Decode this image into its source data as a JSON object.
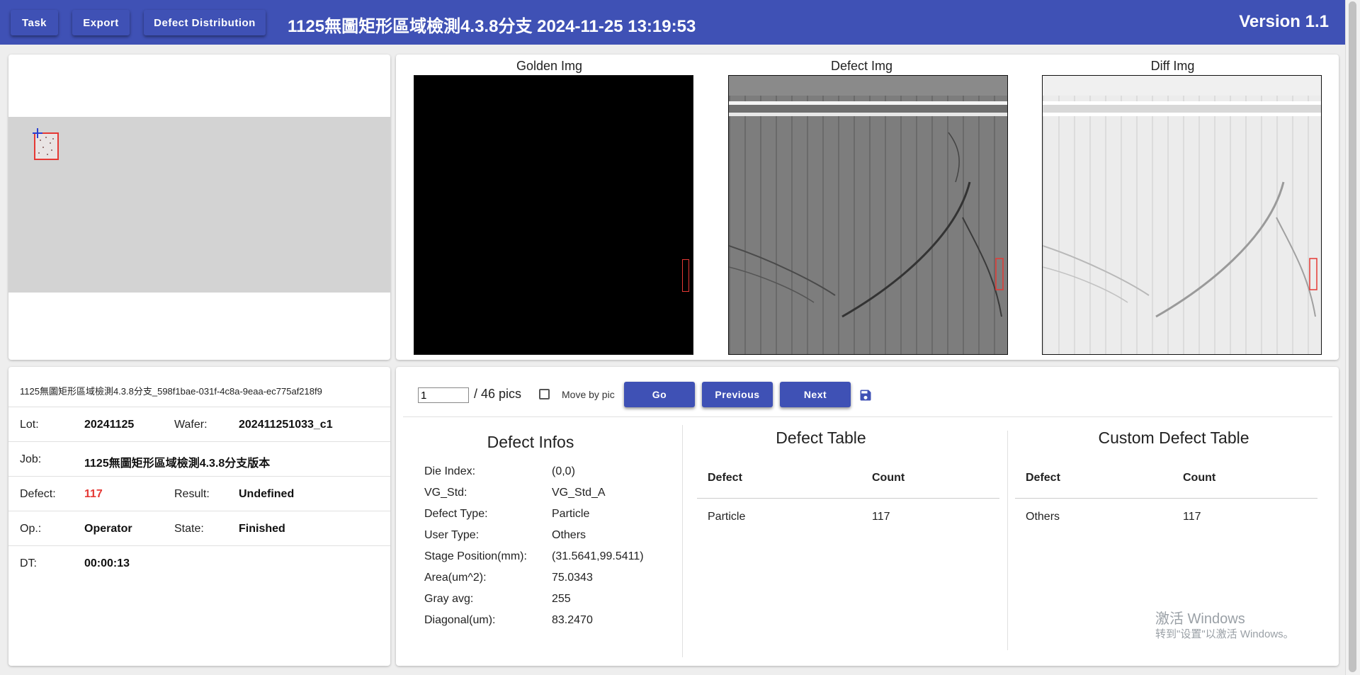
{
  "header": {
    "buttons": [
      "Task",
      "Export",
      "Defect Distribution"
    ],
    "title": "1125無圖矩形區域檢測4.3.8分支   2024-11-25 13:19:53",
    "version": "Version 1.1",
    "color": "#3f51b5"
  },
  "images": {
    "golden_title": "Golden Img",
    "defect_title": "Defect Img",
    "diff_title": "Diff Img"
  },
  "info": {
    "task_name": "1125無圖矩形區域檢測4.3.8分支_598f1bae-031f-4c8a-9eaa-ec775af218f9",
    "lot_label": "Lot:",
    "lot": "20241125",
    "wafer_label": "Wafer:",
    "wafer": "202411251033_c1",
    "job_label": "Job:",
    "job": "1125無圖矩形區域檢測4.3.8分支版本",
    "defect_label": "Defect:",
    "defect": "117",
    "result_label": "Result:",
    "result": "Undefined",
    "op_label": "Op.:",
    "op": "Operator",
    "state_label": "State:",
    "state": "Finished",
    "dt_label": "DT:",
    "dt": "00:00:13",
    "defect_color": "#e53935"
  },
  "controls": {
    "page_value": "1",
    "total": "/ 46 pics",
    "move_by_pic": "Move by pic",
    "go": "Go",
    "previous": "Previous",
    "next": "Next"
  },
  "defect_infos": {
    "title": "Defect Infos",
    "rows": [
      {
        "label": "Die Index:",
        "value": "(0,0)"
      },
      {
        "label": "VG_Std:",
        "value": "VG_Std_A"
      },
      {
        "label": "Defect Type:",
        "value": "Particle"
      },
      {
        "label": "User Type:",
        "value": "Others"
      },
      {
        "label": "Stage Position(mm):",
        "value": "(31.5641,99.5411)"
      },
      {
        "label": "Area(um^2):",
        "value": "75.0343"
      },
      {
        "label": "Gray avg:",
        "value": "255"
      },
      {
        "label": "Diagonal(um):",
        "value": "83.2470"
      }
    ]
  },
  "defect_table": {
    "title": "Defect Table",
    "col_defect": "Defect",
    "col_count": "Count",
    "rows": [
      {
        "defect": "Particle",
        "count": "117"
      }
    ]
  },
  "custom_table": {
    "title": "Custom Defect Table",
    "col_defect": "Defect",
    "col_count": "Count",
    "rows": [
      {
        "defect": "Others",
        "count": "117"
      }
    ]
  },
  "watermark": {
    "line1": "激活 Windows",
    "line2": "转到\"设置\"以激活 Windows。"
  }
}
